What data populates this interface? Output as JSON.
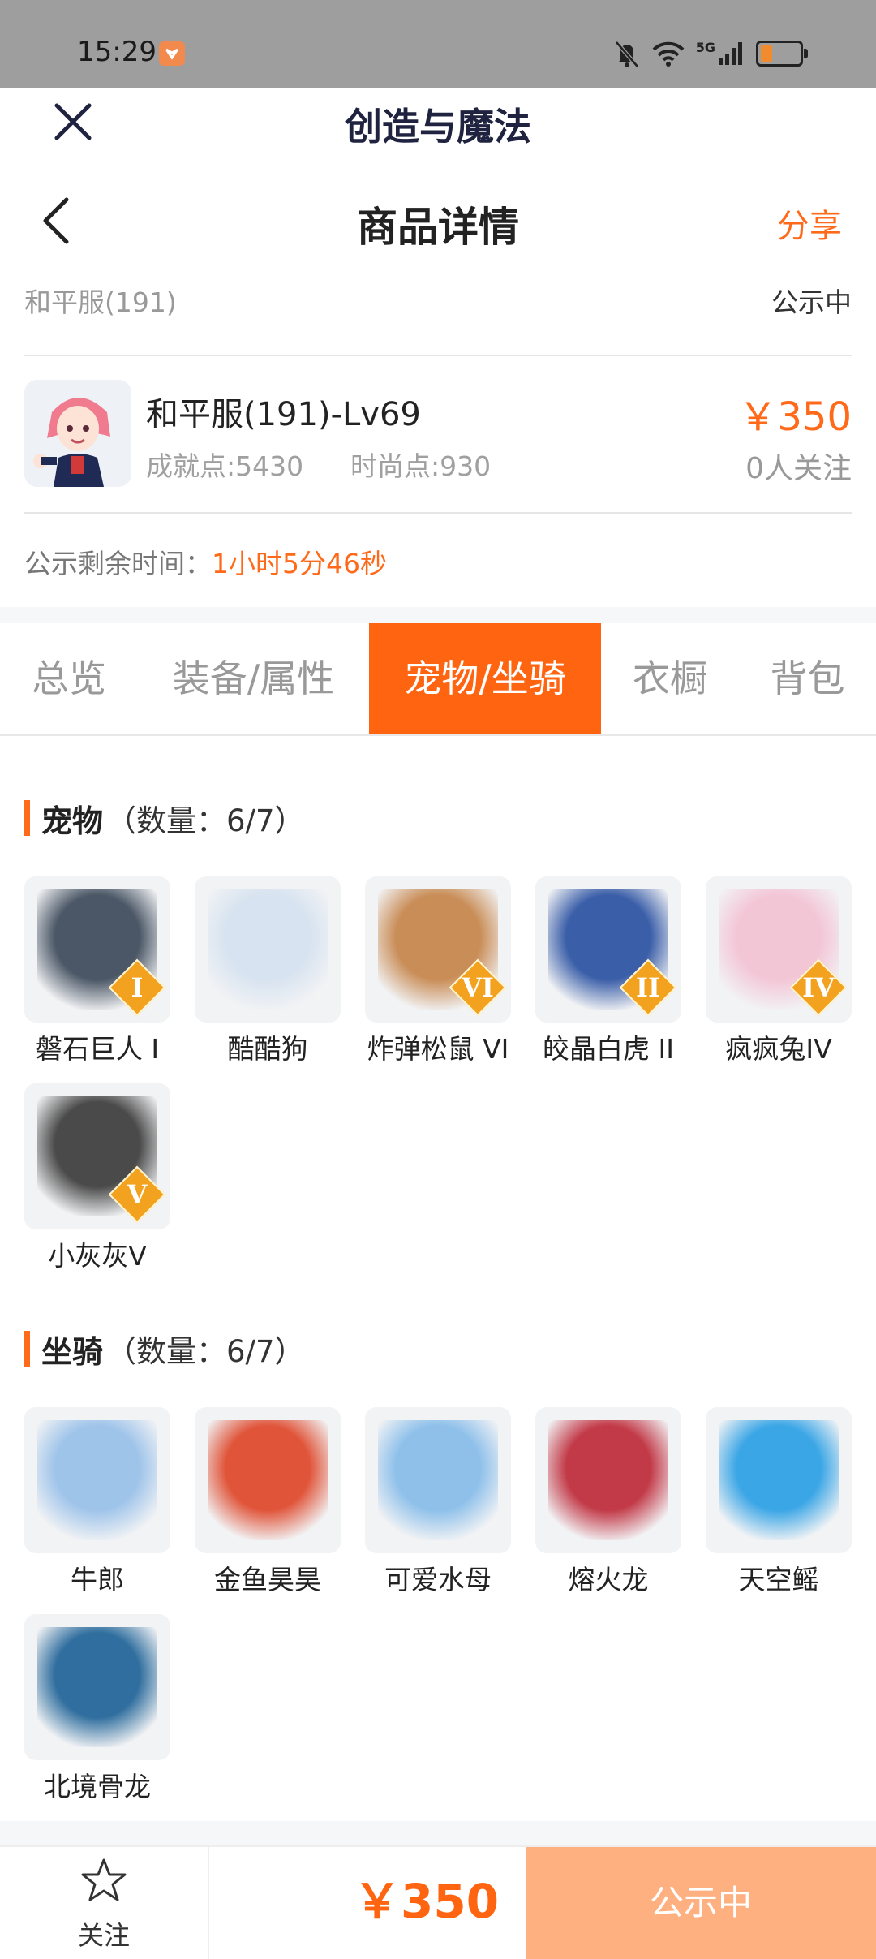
{
  "status_bar": {
    "time": "15:29",
    "network": "5G",
    "battery_level": 0.3
  },
  "app": {
    "title": "创造与魔法"
  },
  "nav": {
    "title": "商品详情",
    "share_label": "分享"
  },
  "server": {
    "name": "和平服(191)",
    "status": "公示中"
  },
  "product": {
    "name": "和平服(191)-Lv69",
    "achievement": "成就点:5430",
    "fashion": "时尚点:930",
    "price": "￥350",
    "followers": "0人关注"
  },
  "timer": {
    "label": "公示剩余时间：",
    "value": "1小时5分46秒"
  },
  "tabs": [
    {
      "label": "总览"
    },
    {
      "label": "装备/属性"
    },
    {
      "label": "宠物/坐骑"
    },
    {
      "label": "衣橱"
    },
    {
      "label": "背包"
    }
  ],
  "active_tab": 2,
  "pets": {
    "title": "宠物",
    "count": "（数量：6/7）",
    "items": [
      {
        "name": "磐石巨人 I",
        "badge": "I",
        "icon": "rock-giant-icon",
        "color": "#4b5766"
      },
      {
        "name": "酷酷狗",
        "badge": "",
        "icon": "cool-dog-icon",
        "color": "#d7e3f0"
      },
      {
        "name": "炸弹松鼠 VI",
        "badge": "VI",
        "icon": "bomb-squirrel-icon",
        "color": "#c98d57"
      },
      {
        "name": "皎晶白虎 II",
        "badge": "II",
        "icon": "white-tiger-icon",
        "color": "#3a5ea8"
      },
      {
        "name": "疯疯兔IV",
        "badge": "IV",
        "icon": "crazy-rabbit-icon",
        "color": "#f3c6d6"
      },
      {
        "name": "小灰灰V",
        "badge": "V",
        "icon": "grey-wolf-icon",
        "color": "#4a4a4a"
      }
    ]
  },
  "mounts": {
    "title": "坐骑",
    "count": "（数量：6/7）",
    "items": [
      {
        "name": "牛郎",
        "icon": "cowherd-icon",
        "color": "#9fc4ea"
      },
      {
        "name": "金鱼昊昊",
        "icon": "goldfish-icon",
        "color": "#e0553a"
      },
      {
        "name": "可爱水母",
        "icon": "jellyfish-icon",
        "color": "#8ec0ea"
      },
      {
        "name": "熔火龙",
        "icon": "fire-dragon-icon",
        "color": "#c23a48"
      },
      {
        "name": "天空鳐",
        "icon": "sky-ray-icon",
        "color": "#3ba6e6"
      },
      {
        "name": "北境骨龙",
        "icon": "bone-dragon-icon",
        "color": "#2f6e9e"
      }
    ]
  },
  "bottom": {
    "follow_label": "关注",
    "price": "￥350",
    "status": "公示中"
  },
  "colors": {
    "accent": "#ff6410",
    "cta_disabled": "#ffb080",
    "title_navy": "#1f2340"
  }
}
